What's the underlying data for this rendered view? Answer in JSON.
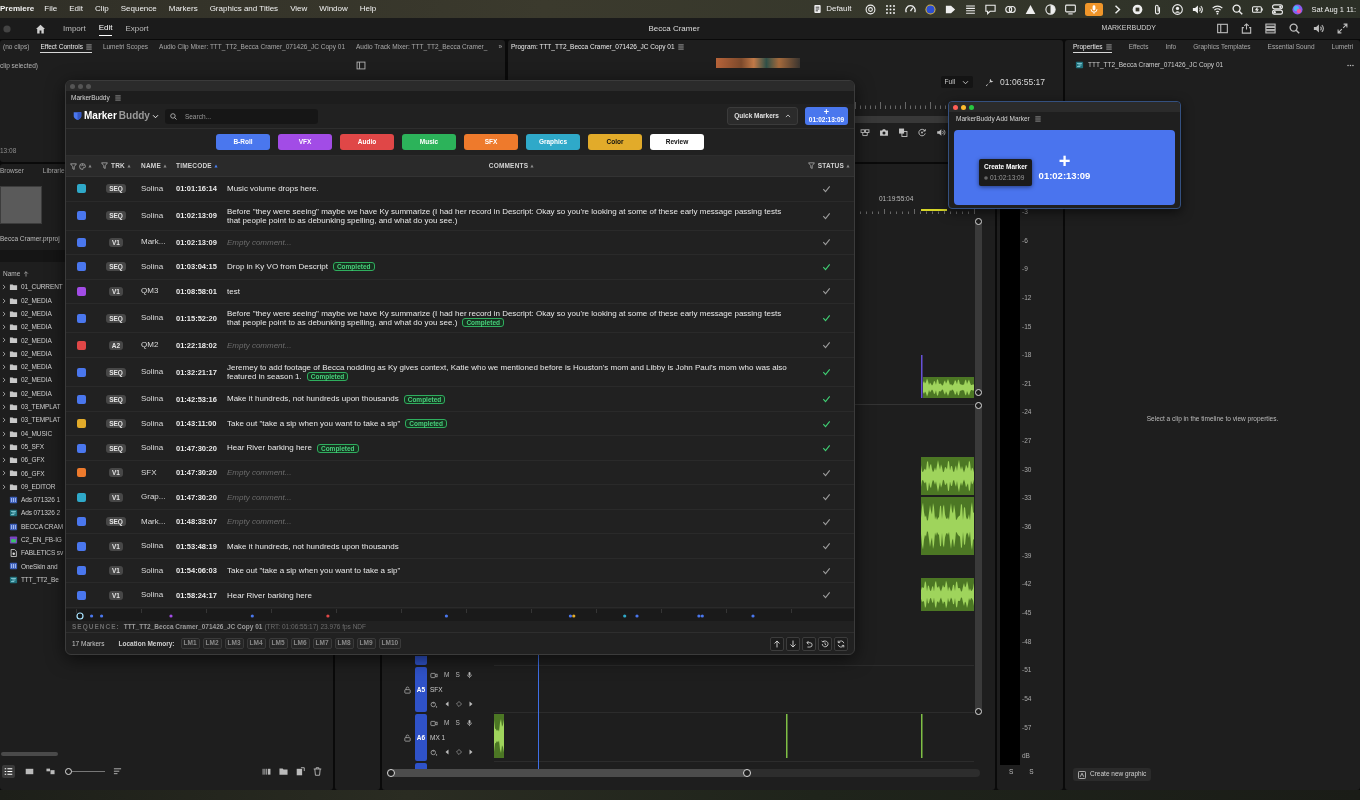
{
  "menu_bar": {
    "app": "Premiere",
    "menus": [
      "File",
      "Edit",
      "Clip",
      "Sequence",
      "Markers",
      "Graphics and Titles",
      "View",
      "Window",
      "Help"
    ],
    "workspace": "Default",
    "clock": "Sat Aug 1 11:"
  },
  "header": {
    "nav": [
      {
        "label": "Import",
        "selected": false
      },
      {
        "label": "Edit",
        "selected": true
      },
      {
        "label": "Export",
        "selected": false
      }
    ],
    "title": "Becca Cramer",
    "extension": "MARKERBUDDY"
  },
  "effects_panel": {
    "tabs": [
      {
        "label": "(no clips)",
        "selected": false
      },
      {
        "label": "Effect Controls",
        "selected": true
      },
      {
        "label": "Lumetri Scopes",
        "selected": false
      },
      {
        "label": "Audio Clip Mixer: TTT_TT2_Becca Cramer_071426_JC Copy 01",
        "selected": false
      },
      {
        "label": "Audio Track Mixer: TTT_TT2_Becca Cramer_",
        "selected": false
      }
    ],
    "overflow": "»",
    "status": "clip selected)",
    "timecode": "13:08"
  },
  "program_monitor": {
    "tab": "Program: TTT_TT2_Becca Cramer_071426_JC Copy 01",
    "resolution": "Full",
    "timecode": "01:06:55:17"
  },
  "project_panel": {
    "tabs": [
      "Browser",
      "Librarie"
    ],
    "project_file": "Becca Cramer.prproj",
    "sort_column": "Name",
    "items": [
      {
        "kind": "folder",
        "name": "01_CURRENT"
      },
      {
        "kind": "folder",
        "name": "02_MEDIA"
      },
      {
        "kind": "folder",
        "name": "02_MEDIA"
      },
      {
        "kind": "folder",
        "name": "02_MEDIA"
      },
      {
        "kind": "folder",
        "name": "02_MEDIA"
      },
      {
        "kind": "folder",
        "name": "02_MEDIA"
      },
      {
        "kind": "folder",
        "name": "02_MEDIA"
      },
      {
        "kind": "folder",
        "name": "02_MEDIA"
      },
      {
        "kind": "folder",
        "name": "02_MEDIA"
      },
      {
        "kind": "folder",
        "name": "03_TEMPLAT"
      },
      {
        "kind": "folder",
        "name": "03_TEMPLAT"
      },
      {
        "kind": "folder",
        "name": "04_MUSIC"
      },
      {
        "kind": "folder",
        "name": "05_SFX"
      },
      {
        "kind": "folder",
        "name": "06_GFX"
      },
      {
        "kind": "folder",
        "name": "06_GFX"
      },
      {
        "kind": "folder",
        "name": "09_EDITOR"
      },
      {
        "kind": "clip",
        "name": "Ads 071326 1"
      },
      {
        "kind": "sequence",
        "name": "Ads 071326 2"
      },
      {
        "kind": "clip",
        "name": "BECCA CRAM"
      },
      {
        "kind": "graphic",
        "name": "C2_EN_FB-IG"
      },
      {
        "kind": "file",
        "name": "FABLETICS sv"
      },
      {
        "kind": "clip",
        "name": "OneSkin and"
      },
      {
        "kind": "sequence",
        "name": "TTT_TT2_Be"
      }
    ],
    "view_modes": [
      {
        "kind": "list",
        "selected": true
      },
      {
        "kind": "grid",
        "selected": false
      },
      {
        "kind": "freeform",
        "selected": false
      }
    ],
    "zoom": {
      "level": 0
    }
  },
  "timeline": {
    "ruler_label": "01:19:55:04",
    "tracks": [
      {
        "label": "A5",
        "name": "SFX",
        "mute": "M",
        "solo": "S"
      },
      {
        "label": "A6",
        "name": "MX 1",
        "mute": "M",
        "solo": "S"
      }
    ]
  },
  "audio_meter": {
    "scale": [
      "-3",
      "-6",
      "-9",
      "-12",
      "-15",
      "-18",
      "-21",
      "-24",
      "-27",
      "-30",
      "-33",
      "-36",
      "-39",
      "-42",
      "-45",
      "-48",
      "-51",
      "-54",
      "-57",
      "dB"
    ],
    "solo": [
      "S",
      "S"
    ]
  },
  "properties_panel": {
    "tabs": [
      {
        "label": "Properties",
        "selected": true
      },
      {
        "label": "Effects",
        "selected": false
      },
      {
        "label": "Info",
        "selected": false
      },
      {
        "label": "Graphics Templates",
        "selected": false
      },
      {
        "label": "Essential Sound",
        "selected": false
      },
      {
        "label": "Lumetri",
        "selected": false
      }
    ],
    "sequence": "TTT_TT2_Becca Cramer_071426_JC Copy 01",
    "message": "Select a clip in the timeline to view properties.",
    "create_button": "Create new graphic"
  },
  "marker_buddy": {
    "window": {
      "active": false
    },
    "panel_title": "MarkerBuddy",
    "logo": {
      "first": "Marker",
      "second": "Buddy"
    },
    "search": {
      "placeholder": "Search..."
    },
    "quick_markers": "Quick Markers",
    "add_button": {
      "symbol": "+",
      "timecode": "01:02:13:09"
    },
    "categories": [
      {
        "label": "B-Roll",
        "color": "#4a77ee"
      },
      {
        "label": "VFX",
        "color": "#a24ce6"
      },
      {
        "label": "Audio",
        "color": "#e04747"
      },
      {
        "label": "Music",
        "color": "#2cb35a"
      },
      {
        "label": "SFX",
        "color": "#ee7a2c"
      },
      {
        "label": "Graphics",
        "color": "#2fa9c9"
      },
      {
        "label": "Color",
        "color": "#e2ab2a"
      },
      {
        "label": "Review",
        "color": "#ffffff"
      }
    ],
    "columns": [
      {
        "kind": "swatch",
        "filterable": true,
        "sorted": false
      },
      {
        "kind": "text",
        "label": "TRK",
        "filterable": true,
        "sorted": false
      },
      {
        "kind": "text",
        "label": "NAME",
        "filterable": false,
        "sorted": false
      },
      {
        "kind": "text",
        "label": "TIMECODE",
        "filterable": false,
        "sorted": true
      },
      {
        "kind": "text",
        "label": "COMMENTS",
        "filterable": false,
        "sorted": false
      },
      {
        "kind": "text",
        "label": "STATUS",
        "filterable": true,
        "sorted": false
      }
    ],
    "markers": [
      {
        "color": "#2fa9c9",
        "track": "SEQ",
        "name": "Solina",
        "timecode": "01:01:16:14",
        "comment": "Music volume drops here.",
        "done": false
      },
      {
        "color": "#4a77ee",
        "track": "SEQ",
        "name": "Solina",
        "timecode": "01:02:13:09",
        "comment": "Before \"they were seeing\" maybe we have Ky summarize (I had her record in Descript: Okay so you're looking at some of these early message passing tests that people point to as debunking spelling, and what do you see.)",
        "done": false
      },
      {
        "color": "#4a77ee",
        "track": "V1",
        "name": "Mark...",
        "timecode": "01:02:13:09",
        "placeholder": "Empty comment...",
        "done": false
      },
      {
        "color": "#4a77ee",
        "track": "SEQ",
        "name": "Solina",
        "timecode": "01:03:04:15",
        "comment": "Drop in Ky VO from Descript",
        "tag": "Completed",
        "done": true
      },
      {
        "color": "#a24ce6",
        "track": "V1",
        "name": "QM3",
        "timecode": "01:08:58:01",
        "comment": "test",
        "done": false
      },
      {
        "color": "#4a77ee",
        "track": "SEQ",
        "name": "Solina",
        "timecode": "01:15:52:20",
        "comment": "Before \"they were seeing\" maybe we have Ky summarize (I had her record in Descript: Okay so you're looking at some of these early message passing tests that people point to as debunking spelling, and what do you see.)",
        "tag": "Completed",
        "done": true
      },
      {
        "color": "#e04747",
        "track": "A2",
        "name": "QM2",
        "timecode": "01:22:18:02",
        "placeholder": "Empty comment...",
        "done": false
      },
      {
        "color": "#4a77ee",
        "track": "SEQ",
        "name": "Solina",
        "timecode": "01:32:21:17",
        "comment": "Jeremey to add footage of Becca nodding as Ky gives context, Katie who we mentioned before is Houston's mom and Libby is John Paul's mom who was also featured in season 1.",
        "tag": "Completed",
        "done": true
      },
      {
        "color": "#4a77ee",
        "track": "SEQ",
        "name": "Solina",
        "timecode": "01:42:53:16",
        "comment": "Make it hundreds, not hundreds upon thousands",
        "tag": "Completed",
        "done": true
      },
      {
        "color": "#e2ab2a",
        "track": "SEQ",
        "name": "Solina",
        "timecode": "01:43:11:00",
        "comment": "Take out \"take a sip when you want to take a sip\"",
        "tag": "Completed",
        "done": true
      },
      {
        "color": "#4a77ee",
        "track": "SEQ",
        "name": "Solina",
        "timecode": "01:47:30:20",
        "comment": "Hear River barking here",
        "tag": "Completed",
        "done": true
      },
      {
        "color": "#ee7a2c",
        "track": "V1",
        "name": "SFX",
        "timecode": "01:47:30:20",
        "placeholder": "Empty comment...",
        "done": false
      },
      {
        "color": "#2fa9c9",
        "track": "V1",
        "name": "Grap...",
        "timecode": "01:47:30:20",
        "placeholder": "Empty comment...",
        "done": false
      },
      {
        "color": "#4a77ee",
        "track": "SEQ",
        "name": "Mark...",
        "timecode": "01:48:33:07",
        "placeholder": "Empty comment...",
        "done": false
      },
      {
        "color": "#4a77ee",
        "track": "V1",
        "name": "Solina",
        "timecode": "01:53:48:19",
        "comment": "Make it hundreds, not hundreds upon thousands",
        "done": false
      },
      {
        "color": "#4a77ee",
        "track": "V1",
        "name": "Solina",
        "timecode": "01:54:06:03",
        "comment": "Take out \"take a sip when you want to take a sip\"",
        "done": false
      },
      {
        "color": "#4a77ee",
        "track": "V1",
        "name": "Solina",
        "timecode": "01:58:24:17",
        "comment": "Hear River barking here",
        "done": false
      }
    ],
    "sequence": {
      "label": "SEQUENCE:",
      "name": "TTT_TT2_Becca Cramer_071426_JC Copy 01",
      "duration": "(TRT: 01:06:55:17)",
      "rate": "23.976 fps NDF"
    },
    "count": "17 Markers",
    "location_memory": {
      "label": "Location Memory:",
      "slots": [
        "LM1",
        "LM2",
        "LM3",
        "LM4",
        "LM5",
        "LM6",
        "LM7",
        "LM8",
        "LM9",
        "LM10"
      ]
    }
  },
  "add_marker": {
    "window": {
      "active": true
    },
    "title": "MarkerBuddy Add Marker",
    "symbol": "+",
    "timecode": "01:02:13:09",
    "tooltip": {
      "title": "Create Marker",
      "timecode": "01:02:13:09"
    }
  }
}
